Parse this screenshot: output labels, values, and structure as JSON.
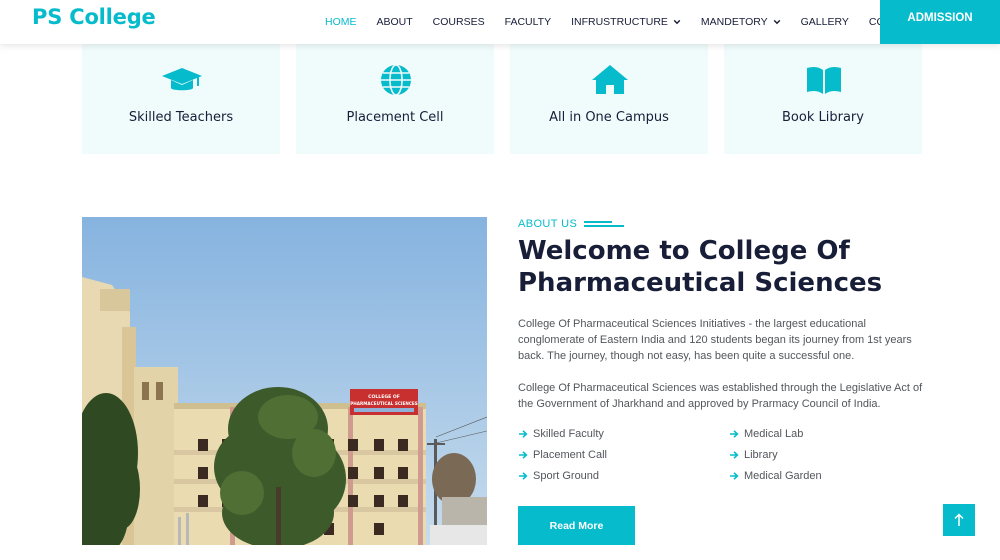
{
  "header": {
    "brand": "PS College",
    "nav": [
      {
        "label": "HOME"
      },
      {
        "label": "ABOUT"
      },
      {
        "label": "COURSES"
      },
      {
        "label": "FACULTY"
      },
      {
        "label": "INFRUSTRUCTURE"
      },
      {
        "label": "MANDETORY"
      },
      {
        "label": "GALLERY"
      },
      {
        "label": "CONTACT"
      }
    ],
    "admission_label": "ADMISSION"
  },
  "features": [
    {
      "icon": "graduation-cap-icon",
      "title": "Skilled Teachers"
    },
    {
      "icon": "globe-icon",
      "title": "Placement Cell"
    },
    {
      "icon": "home-icon",
      "title": "All in One Campus"
    },
    {
      "icon": "book-open-icon",
      "title": "Book Library"
    }
  ],
  "about": {
    "eyebrow": "ABOUT US",
    "heading": "Welcome to College Of Pharmaceutical Sciences",
    "paragraph1": "College Of Pharmaceutical Sciences Initiatives - the largest educational conglomerate of Eastern India and 120 students began its journey from 1st years back. The journey, though not easy, has been quite a successful one.",
    "paragraph2": "College Of Pharmaceutical Sciences was established through the Legislative Act of the Government of Jharkhand and approved by Prarmacy Council of India.",
    "list": [
      "Skilled Faculty",
      "Medical Lab",
      "Placement Call",
      "Library",
      "Sport Ground",
      "Medical Garden"
    ],
    "read_more_label": "Read More",
    "photo_sign": [
      "COLLEGE OF",
      "PHARMACEUTICAL SCIENCES"
    ]
  },
  "colors": {
    "accent": "#06BBCC",
    "heading": "#181d38",
    "card_bg": "#F0FBFC"
  },
  "back_to_top_icon": "arrow-up-icon"
}
